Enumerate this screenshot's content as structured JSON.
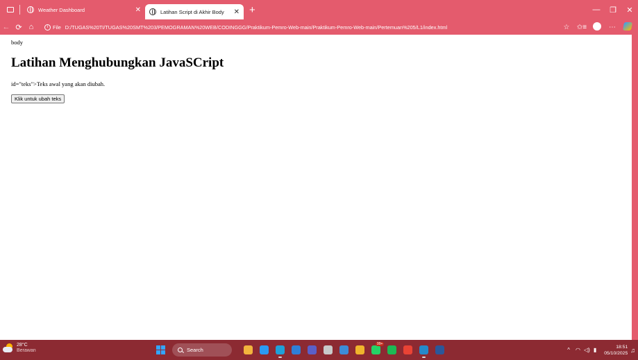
{
  "browser": {
    "tabs": [
      {
        "title": "Weather Dashboard",
        "active": false
      },
      {
        "title": "Latihan Script di Akhir Body",
        "active": true
      }
    ],
    "new_tab_label": "+",
    "window_controls": {
      "minimize": "—",
      "restore": "❐",
      "close": "✕"
    },
    "address": {
      "scheme_label": "File",
      "url": "D:/TUGAS%20TI/TUGAS%20SMT%203/PEMOGRAMAN%20WEB/CODINGGG/Praktikum-Pemro-Web-main/Praktikum-Pemro-Web-main/Pertemuan%205/L1/index.html"
    },
    "icons": {
      "back": "←",
      "reload": "⟳",
      "home": "⌂",
      "favorite": "☆",
      "favorites_list": "✩≡",
      "more": "⋯"
    }
  },
  "page": {
    "body_label": "body",
    "heading": "Latihan Menghubungkan JavaSCript",
    "paragraph": "id=\"teks\">Teks awal yang akan diubah.",
    "button_label": "Klik untuk ubah teks"
  },
  "taskbar": {
    "weather": {
      "temp": "28°C",
      "condition": "Berawan"
    },
    "search_placeholder": "Search",
    "apps": [
      {
        "name": "file-explorer",
        "color": "#f3b43d"
      },
      {
        "name": "copilot",
        "color": "#2b9af3"
      },
      {
        "name": "edge",
        "color": "#1fa0d8"
      },
      {
        "name": "mail",
        "color": "#2f7fd8"
      },
      {
        "name": "teams",
        "color": "#5b5fc7"
      },
      {
        "name": "github",
        "color": "#c9c9c9"
      },
      {
        "name": "onenote",
        "color": "#3d8cd8"
      },
      {
        "name": "folder",
        "color": "#f0b42c"
      },
      {
        "name": "whatsapp",
        "color": "#25d366"
      },
      {
        "name": "spotify",
        "color": "#1db954"
      },
      {
        "name": "chrome",
        "color": "#ea4335"
      },
      {
        "name": "vscode",
        "color": "#2489ca"
      },
      {
        "name": "word",
        "color": "#2b579a"
      }
    ],
    "badge": "99+",
    "clock_time": "18:51",
    "clock_date": "05/10/2025",
    "accent": "#e45b6d"
  }
}
